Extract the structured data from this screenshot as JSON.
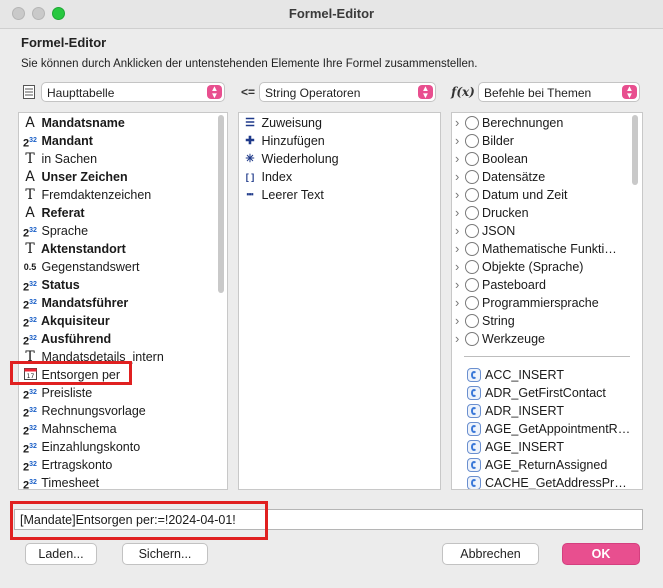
{
  "window": {
    "title": "Formel-Editor"
  },
  "heading": "Formel-Editor",
  "subtext": "Sie können durch Anklicken der untenstehenden Elemente Ihre Formel zusammenstellen.",
  "selectors": {
    "table": {
      "icon": "table-icon",
      "value": "Haupttabelle"
    },
    "operators": {
      "icon": "operator-icon",
      "icon_text": "<=",
      "value": "String Operatoren"
    },
    "commands": {
      "icon": "function-icon",
      "icon_text": "f(x)",
      "value": "Befehle bei Themen"
    }
  },
  "fields": [
    {
      "label": "Mandatsname",
      "bold": true,
      "icon": "text-field-icon",
      "glyph": "A"
    },
    {
      "label": "Mandant",
      "bold": true,
      "icon": "number-field-icon",
      "glyph": "2",
      "sup": "32"
    },
    {
      "label": "in Sachen",
      "bold": false,
      "icon": "text-icon",
      "glyph": "T"
    },
    {
      "label": "Unser Zeichen",
      "bold": true,
      "icon": "text-field-icon",
      "glyph": "A"
    },
    {
      "label": "Fremdaktenzeichen",
      "bold": false,
      "icon": "text-icon",
      "glyph": "T"
    },
    {
      "label": "Referat",
      "bold": true,
      "icon": "text-field-icon",
      "glyph": "A"
    },
    {
      "label": "Sprache",
      "bold": false,
      "icon": "number-field-icon",
      "glyph": "2",
      "sup": "32"
    },
    {
      "label": "Aktenstandort",
      "bold": true,
      "icon": "text-icon",
      "glyph": "T"
    },
    {
      "label": "Gegenstandswert",
      "bold": false,
      "icon": "real-field-icon",
      "glyph": "0.5"
    },
    {
      "label": "Status",
      "bold": true,
      "icon": "number-field-icon",
      "glyph": "2",
      "sup": "32"
    },
    {
      "label": "Mandatsführer",
      "bold": true,
      "icon": "number-field-icon",
      "glyph": "2",
      "sup": "32"
    },
    {
      "label": "Akquisiteur",
      "bold": true,
      "icon": "number-field-icon",
      "glyph": "2",
      "sup": "32"
    },
    {
      "label": "Ausführend",
      "bold": true,
      "icon": "number-field-icon",
      "glyph": "2",
      "sup": "32"
    },
    {
      "label": "Mandatsdetails_intern",
      "bold": false,
      "icon": "text-icon",
      "glyph": "T"
    },
    {
      "label": "Entsorgen per",
      "bold": false,
      "icon": "calendar-icon",
      "glyph": "17",
      "highlighted": true
    },
    {
      "label": "Preisliste",
      "bold": false,
      "icon": "number-field-icon",
      "glyph": "2",
      "sup": "32"
    },
    {
      "label": "Rechnungsvorlage",
      "bold": false,
      "icon": "number-field-icon",
      "glyph": "2",
      "sup": "32"
    },
    {
      "label": "Mahnschema",
      "bold": false,
      "icon": "number-field-icon",
      "glyph": "2",
      "sup": "32"
    },
    {
      "label": "Einzahlungskonto",
      "bold": false,
      "icon": "number-field-icon",
      "glyph": "2",
      "sup": "32"
    },
    {
      "label": "Ertragskonto",
      "bold": false,
      "icon": "number-field-icon",
      "glyph": "2",
      "sup": "32"
    },
    {
      "label": "Timesheet",
      "bold": false,
      "icon": "number-field-icon",
      "glyph": "2",
      "sup": "32"
    }
  ],
  "operators": [
    {
      "label": "Zuweisung",
      "icon": "assign-icon",
      "glyph": "☰"
    },
    {
      "label": "Hinzufügen",
      "icon": "plus-icon",
      "glyph": "✚"
    },
    {
      "label": "Wiederholung",
      "icon": "asterisk-icon",
      "glyph": "✳"
    },
    {
      "label": "Index",
      "icon": "index-icon",
      "glyph": "[ ]"
    },
    {
      "label": "Leerer Text",
      "icon": "empty-text-icon",
      "glyph": "┅"
    }
  ],
  "themes": [
    "Berechnungen",
    "Bilder",
    "Boolean",
    "Datensätze",
    "Datum und Zeit",
    "Drucken",
    "JSON",
    "Mathematische Funkti…",
    "Objekte (Sprache)",
    "Pasteboard",
    "Programmiersprache",
    "String",
    "Werkzeuge"
  ],
  "methods": [
    "ACC_INSERT",
    "ADR_GetFirstContact",
    "ADR_INSERT",
    "AGE_GetAppointmentR…",
    "AGE_INSERT",
    "AGE_ReturnAssigned",
    "CACHE_GetAddressPr…"
  ],
  "formula": "[Mandate]Entsorgen per:=!2024-04-01!",
  "buttons": {
    "load": "Laden...",
    "save": "Sichern...",
    "cancel": "Abbrechen",
    "ok": "OK"
  },
  "colors": {
    "accent": "#e84f8f",
    "highlight": "#e02020"
  }
}
